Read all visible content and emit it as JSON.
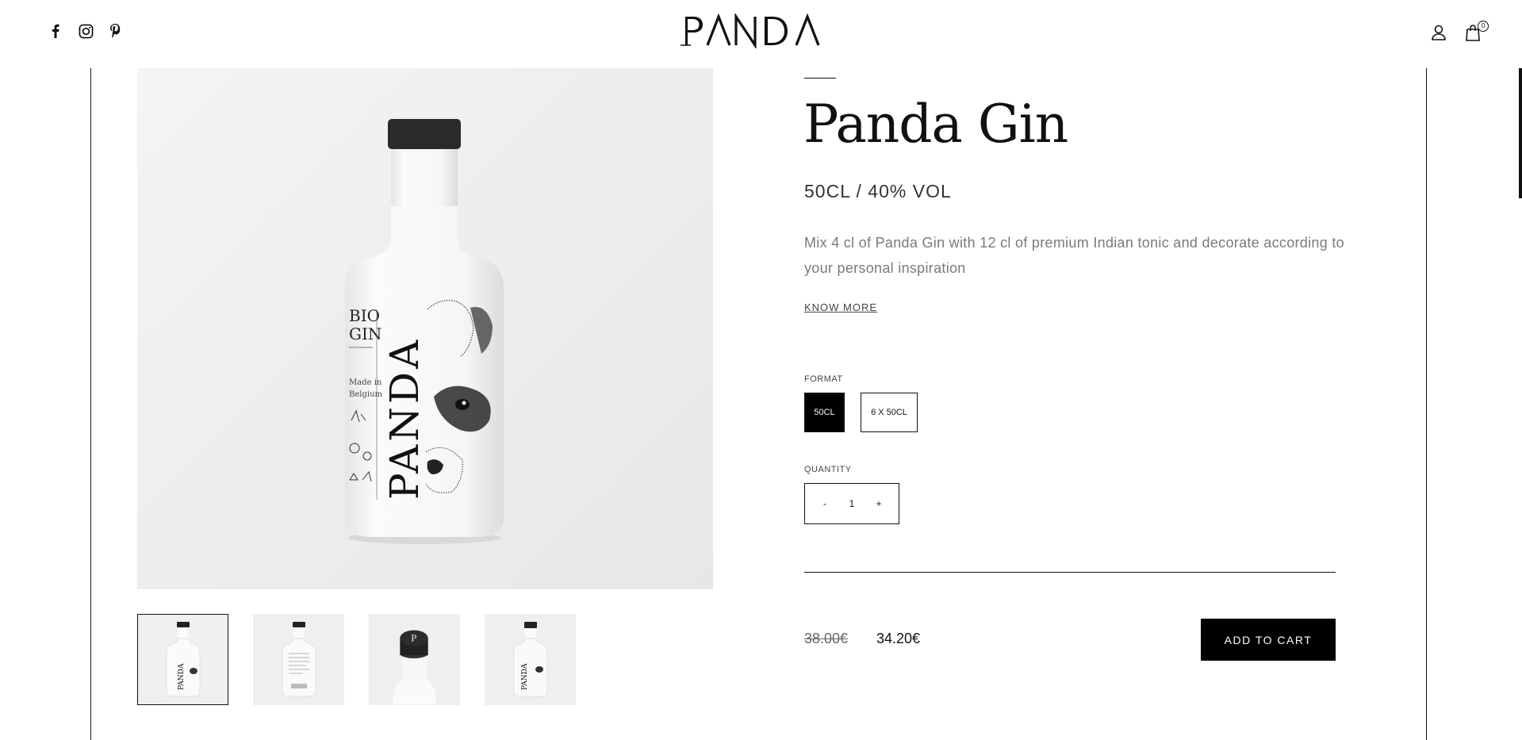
{
  "header": {
    "logo": "PANDA",
    "social": [
      {
        "icon": "facebook-icon"
      },
      {
        "icon": "instagram-icon"
      },
      {
        "icon": "pinterest-icon"
      }
    ],
    "account_icon": "user-icon",
    "cart_icon": "shopping-bag-icon",
    "cart_count": "0"
  },
  "product": {
    "title": "Panda Gin",
    "subtitle": "50CL / 40% VOL",
    "description": "Mix 4 cl of Panda Gin with 12 cl of premium Indian tonic and decorate according to your personal inspiration",
    "know_more": "KNOW MORE",
    "format": {
      "label": "FORMAT",
      "options": [
        "50CL",
        "6 X 50CL"
      ],
      "selected": "50CL"
    },
    "quantity": {
      "label": "QUANTITY",
      "minus": "-",
      "value": "1",
      "plus": "+"
    },
    "price_old": "38.00€",
    "price_new": "34.20€",
    "add_to_cart": "ADD TO CART",
    "bottle_label": {
      "brand": "PANDA",
      "line1": "BIO",
      "line2": "GIN",
      "made_in": "Made in Belgium"
    }
  },
  "gallery": {
    "thumbnails": 4,
    "active": 0
  },
  "colors": {
    "text": "#111111",
    "muted": "#7a7a7a",
    "button_bg": "#000000",
    "button_text": "#ffffff",
    "image_bg": "#efefef"
  }
}
